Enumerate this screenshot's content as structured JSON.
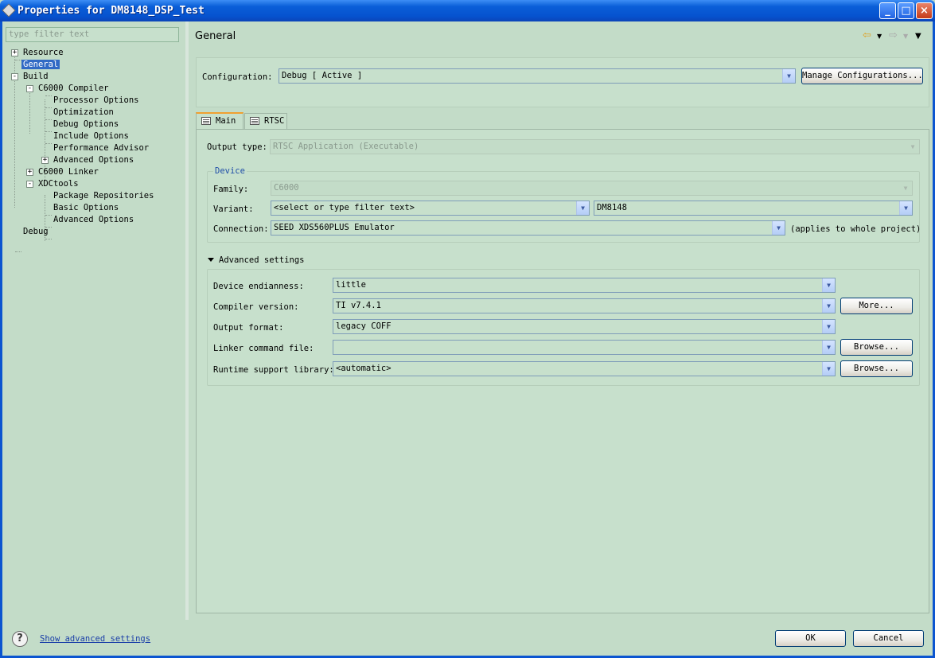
{
  "window": {
    "title": "Properties for DM8148_DSP_Test",
    "controls": {
      "minimize": "_",
      "maximize": "□",
      "close": "×"
    }
  },
  "sidebar": {
    "filter_placeholder": "type filter text",
    "items": [
      {
        "label": "Resource",
        "expander": "+"
      },
      {
        "label": "General",
        "selected": true
      },
      {
        "label": "Build",
        "expander": "-"
      },
      {
        "label": "C6000 Compiler",
        "expander": "-"
      },
      {
        "label": "Processor Options"
      },
      {
        "label": "Optimization"
      },
      {
        "label": "Debug Options"
      },
      {
        "label": "Include Options"
      },
      {
        "label": "Performance Advisor"
      },
      {
        "label": "Advanced Options",
        "expander": "+"
      },
      {
        "label": "C6000 Linker",
        "expander": "+"
      },
      {
        "label": "XDCtools",
        "expander": "-"
      },
      {
        "label": "Package Repositories"
      },
      {
        "label": "Basic Options"
      },
      {
        "label": "Advanced Options"
      },
      {
        "label": "Debug"
      }
    ]
  },
  "header": {
    "title": "General",
    "icons": [
      "back-arrow-icon",
      "forward-arrow-icon",
      "view-menu-icon"
    ]
  },
  "config": {
    "label": "Configuration:",
    "value": "Debug  [ Active ]",
    "manage_button": "Manage Configurations..."
  },
  "tabs": [
    {
      "label": "Main",
      "active": true
    },
    {
      "label": "RTSC",
      "active": false
    }
  ],
  "main": {
    "output_type_label": "Output type:",
    "output_type_value": "RTSC Application (Executable)",
    "device": {
      "title": "Device",
      "family_label": "Family:",
      "family_value": "C6000",
      "variant_label": "Variant:",
      "variant_filter": "<select or type filter text>",
      "variant_value": "DM8148",
      "connection_label": "Connection:",
      "connection_value": "SEED XDS560PLUS Emulator",
      "connection_note": "(applies to whole project)"
    },
    "advanced": {
      "toggle_label": "Advanced settings",
      "endianness_label": "Device endianness:",
      "endianness_value": "little",
      "compiler_label": "Compiler version:",
      "compiler_value": "TI v7.4.1",
      "more_button": "More...",
      "output_format_label": "Output format:",
      "output_format_value": "legacy COFF",
      "linker_label": "Linker command file:",
      "linker_value": "",
      "browse_button": "Browse...",
      "runtime_label": "Runtime support library:",
      "runtime_value": "<automatic>",
      "browse_button2": "Browse..."
    }
  },
  "footer": {
    "help_icon": "?",
    "link": "Show advanced settings",
    "ok_button": "OK",
    "cancel_button": "Cancel"
  }
}
